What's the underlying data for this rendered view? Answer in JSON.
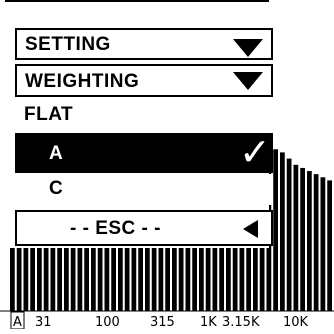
{
  "menu": {
    "setting": "SETTING",
    "weighting": "WEIGHTING",
    "options": [
      "FLAT",
      "A",
      "C"
    ],
    "selected": "A",
    "check": "✓",
    "esc": "- - ESC - -"
  },
  "axis": {
    "mode": "A",
    "labels": [
      "31",
      "100",
      "315",
      "1K",
      "3.15K",
      "10K"
    ]
  },
  "spectrum": {
    "levels": [
      0.59,
      0.23,
      0.29,
      0.31,
      0.34,
      0.39,
      0.41,
      0.45,
      0.47,
      0.49,
      0.5,
      0.51,
      0.52,
      0.52,
      0.53,
      0.53,
      0.53,
      0.52,
      0.53,
      0.52,
      0.52,
      0.51,
      0.52,
      0.52,
      0.52,
      0.51,
      0.51,
      0.53,
      0.52,
      0.51,
      0.5,
      0.51,
      0.52,
      0.51,
      0.51,
      0.5,
      0.51,
      0.51,
      0.52,
      0.52,
      0.51,
      0.49,
      0.47,
      0.46,
      0.45,
      0.44,
      0.43,
      0.42
    ]
  }
}
